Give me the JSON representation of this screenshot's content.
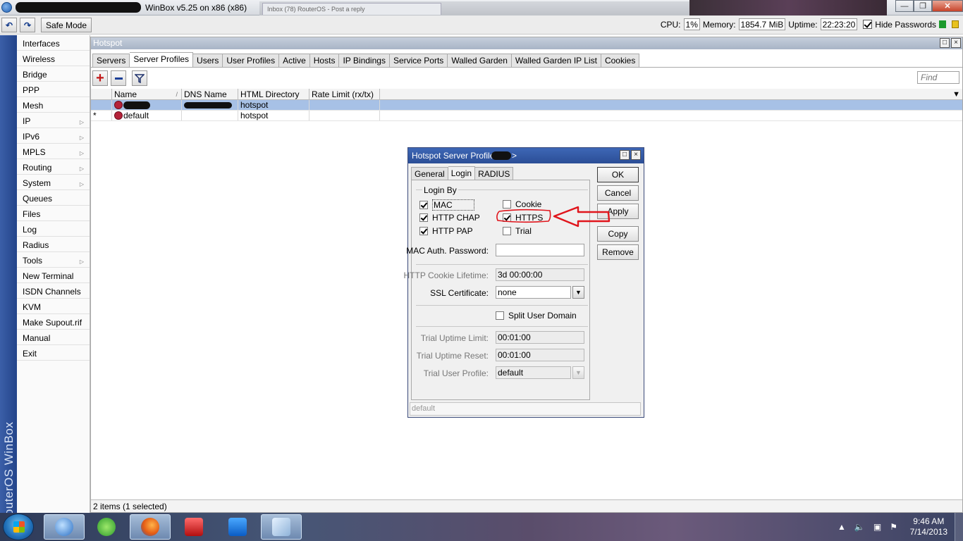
{
  "window": {
    "title": "WinBox v5.25 on x86 (x86)",
    "bg_tab": "Inbox (78) RouterOS - Post a reply"
  },
  "toolbar": {
    "undo_icon": "undo-icon",
    "redo_icon": "redo-icon",
    "safe_mode": "Safe Mode",
    "cpu_label": "CPU:",
    "cpu_value": "1%",
    "memory_label": "Memory:",
    "memory_value": "1854.7 MiB",
    "uptime_label": "Uptime:",
    "uptime_value": "22:23:20",
    "hide_passwords": "Hide Passwords",
    "hide_passwords_checked": true
  },
  "sidebar_brand": "RouterOS WinBox",
  "menu": [
    {
      "label": "Interfaces",
      "arrow": false
    },
    {
      "label": "Wireless",
      "arrow": false
    },
    {
      "label": "Bridge",
      "arrow": false
    },
    {
      "label": "PPP",
      "arrow": false
    },
    {
      "label": "Mesh",
      "arrow": false
    },
    {
      "label": "IP",
      "arrow": true
    },
    {
      "label": "IPv6",
      "arrow": true
    },
    {
      "label": "MPLS",
      "arrow": true
    },
    {
      "label": "Routing",
      "arrow": true
    },
    {
      "label": "System",
      "arrow": true
    },
    {
      "label": "Queues",
      "arrow": false
    },
    {
      "label": "Files",
      "arrow": false
    },
    {
      "label": "Log",
      "arrow": false
    },
    {
      "label": "Radius",
      "arrow": false
    },
    {
      "label": "Tools",
      "arrow": true
    },
    {
      "label": "New Terminal",
      "arrow": false
    },
    {
      "label": "ISDN Channels",
      "arrow": false
    },
    {
      "label": "KVM",
      "arrow": false
    },
    {
      "label": "Make Supout.rif",
      "arrow": false
    },
    {
      "label": "Manual",
      "arrow": false
    },
    {
      "label": "Exit",
      "arrow": false
    }
  ],
  "hotspot": {
    "title": "Hotspot",
    "tabs": [
      "Servers",
      "Server Profiles",
      "Users",
      "User Profiles",
      "Active",
      "Hosts",
      "IP Bindings",
      "Service Ports",
      "Walled Garden",
      "Walled Garden IP List",
      "Cookies"
    ],
    "active_tab": "Server Profiles",
    "find_placeholder": "Find",
    "columns": [
      "Name",
      "DNS Name",
      "HTML Directory",
      "Rate Limit (rx/tx)"
    ],
    "rows": [
      {
        "marker": "",
        "name": "",
        "dns": "",
        "html": "hotspot",
        "rate": "",
        "selected": true
      },
      {
        "marker": "*",
        "name": "default",
        "dns": "",
        "html": "hotspot",
        "rate": "",
        "selected": false
      }
    ],
    "status": "2 items (1 selected)"
  },
  "dialog": {
    "title": "Hotspot Server Profile <",
    "title_end": ">",
    "tabs": [
      "General",
      "Login",
      "RADIUS"
    ],
    "active_tab": "Login",
    "buttons": {
      "ok": "OK",
      "cancel": "Cancel",
      "apply": "Apply",
      "copy": "Copy",
      "remove": "Remove"
    },
    "login_by_label": "Login By",
    "checkboxes": {
      "mac": {
        "label": "MAC",
        "checked": true
      },
      "cookie": {
        "label": "Cookie",
        "checked": false
      },
      "http_chap": {
        "label": "HTTP CHAP",
        "checked": true
      },
      "https": {
        "label": "HTTPS",
        "checked": true
      },
      "http_pap": {
        "label": "HTTP PAP",
        "checked": true
      },
      "trial": {
        "label": "Trial",
        "checked": false
      },
      "split_user_domain": {
        "label": "Split User Domain",
        "checked": false
      }
    },
    "fields": {
      "mac_auth_password": {
        "label": "MAC Auth. Password:",
        "value": ""
      },
      "http_cookie_lifetime": {
        "label": "HTTP Cookie Lifetime:",
        "value": "3d 00:00:00"
      },
      "ssl_certificate": {
        "label": "SSL Certificate:",
        "value": "none"
      },
      "trial_uptime_limit": {
        "label": "Trial Uptime Limit:",
        "value": "00:01:00"
      },
      "trial_uptime_reset": {
        "label": "Trial Uptime Reset:",
        "value": "00:01:00"
      },
      "trial_user_profile": {
        "label": "Trial User Profile:",
        "value": "default"
      }
    },
    "status": "default"
  },
  "annotation": {
    "color": "#e0151c"
  },
  "taskbar": {
    "apps": [
      "winbox-app-icon",
      "utorrent-app-icon",
      "firefox-app-icon",
      "acrobat-app-icon",
      "teamviewer-app-icon",
      "notepad-app-icon"
    ],
    "time": "9:46 AM",
    "date": "7/14/2013"
  }
}
